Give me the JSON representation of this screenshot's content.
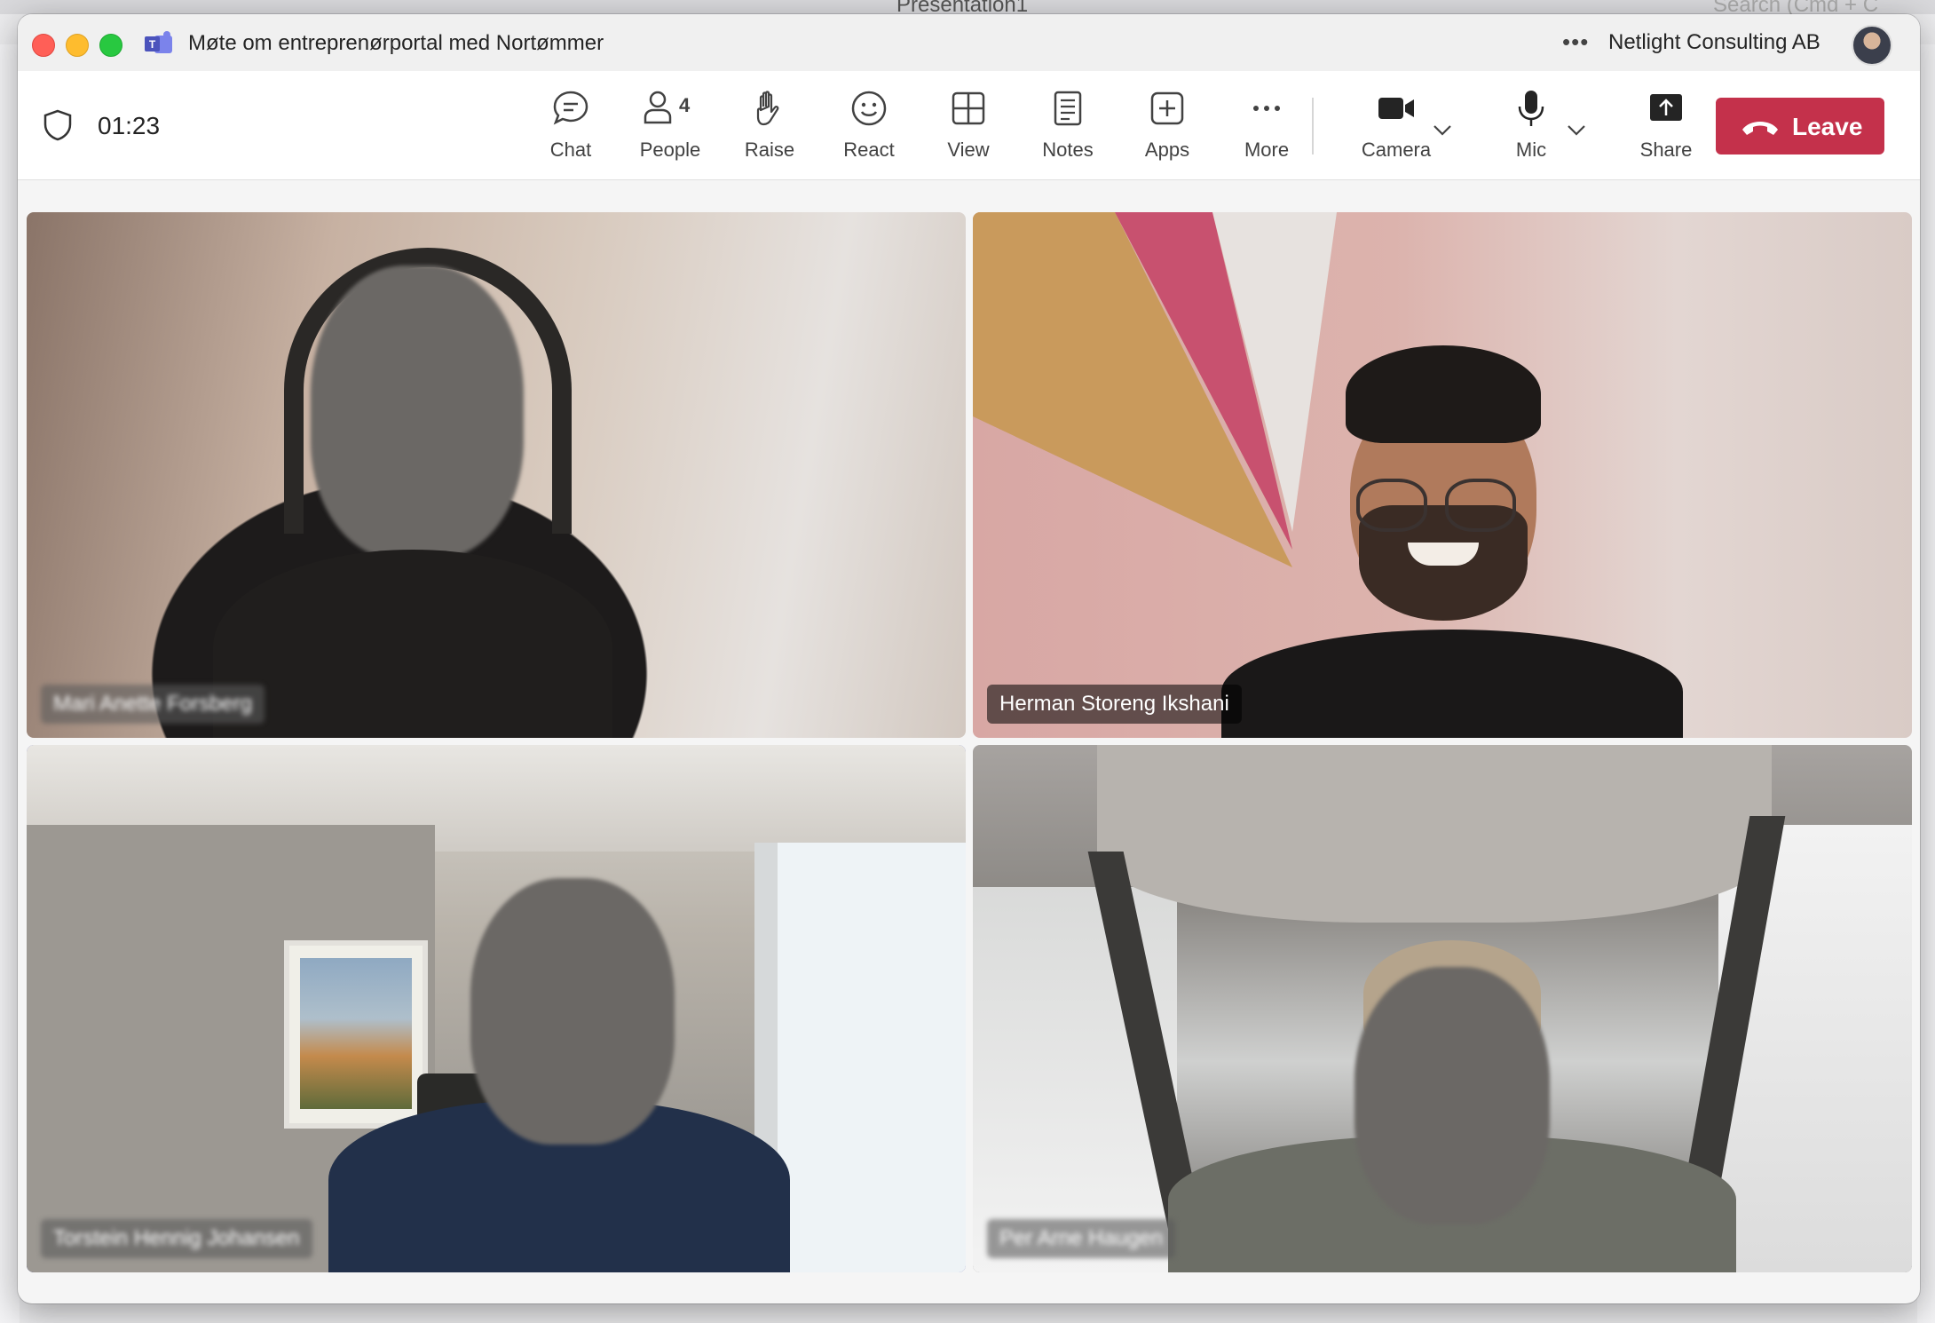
{
  "background_app": {
    "title": "Presentation1",
    "search_placeholder": "Search (Cmd + C"
  },
  "window": {
    "title": "Møte om entreprenørportal med Nortømmer",
    "org_name": "Netlight Consulting AB",
    "more_dots": "•••"
  },
  "toolbar": {
    "timer": "01:23",
    "chat": "Chat",
    "people": "People",
    "people_count": "4",
    "raise": "Raise",
    "react": "React",
    "view": "View",
    "notes": "Notes",
    "apps": "Apps",
    "more": "More",
    "camera": "Camera",
    "mic": "Mic",
    "share": "Share",
    "leave": "Leave"
  },
  "participants": [
    {
      "name": "Mari Anette Forsberg",
      "blurred_name": true
    },
    {
      "name": "Herman Storeng Ikshani",
      "blurred_name": false
    },
    {
      "name": "Torstein Hennig Johansen",
      "blurred_name": true,
      "active_speaker": true
    },
    {
      "name": "Per Arne Haugen",
      "blurred_name": true
    }
  ],
  "colors": {
    "leave": "#c4314b",
    "active_speaker_border": "#5b5fc7",
    "teams_purple": "#5b5fc7"
  }
}
